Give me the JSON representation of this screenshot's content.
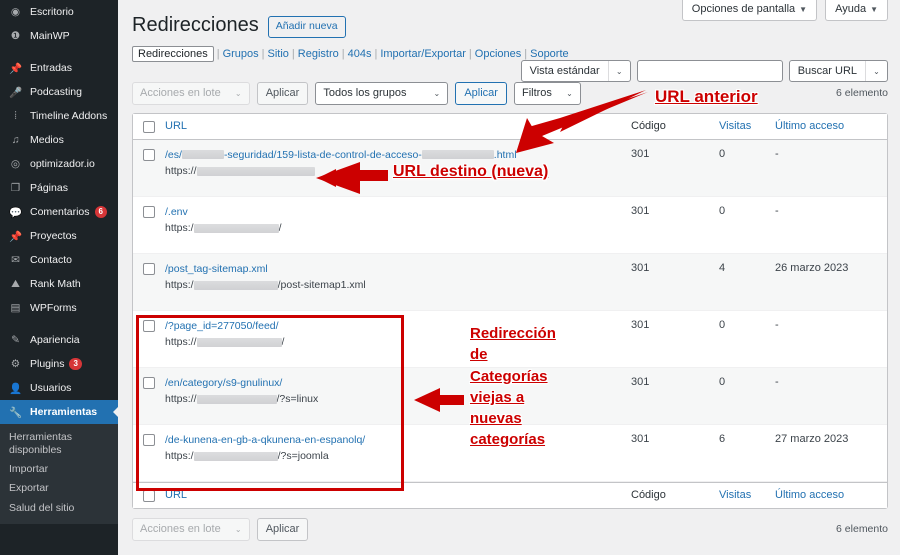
{
  "sidebar": {
    "items": [
      {
        "label": "Escritorio",
        "icon": "dashboard-icon",
        "badge": "",
        "gap": false,
        "active": false
      },
      {
        "label": "MainWP",
        "icon": "mainwp-icon",
        "badge": "",
        "gap": false,
        "active": false
      },
      {
        "label": "Entradas",
        "icon": "pin-icon",
        "badge": "",
        "gap": true,
        "active": false
      },
      {
        "label": "Podcasting",
        "icon": "microphone-icon",
        "badge": "",
        "gap": false,
        "active": false
      },
      {
        "label": "Timeline Addons",
        "icon": "timeline-icon",
        "badge": "",
        "gap": false,
        "active": false
      },
      {
        "label": "Medios",
        "icon": "media-icon",
        "badge": "",
        "gap": false,
        "active": false
      },
      {
        "label": "optimizador.io",
        "icon": "speed-icon",
        "badge": "",
        "gap": false,
        "active": false
      },
      {
        "label": "Páginas",
        "icon": "pages-icon",
        "badge": "",
        "gap": false,
        "active": false
      },
      {
        "label": "Comentarios",
        "icon": "comment-icon",
        "badge": "6",
        "gap": false,
        "active": false
      },
      {
        "label": "Proyectos",
        "icon": "pin-icon",
        "badge": "",
        "gap": false,
        "active": false
      },
      {
        "label": "Contacto",
        "icon": "envelope-icon",
        "badge": "",
        "gap": false,
        "active": false
      },
      {
        "label": "Rank Math",
        "icon": "rankmath-icon",
        "badge": "",
        "gap": false,
        "active": false
      },
      {
        "label": "WPForms",
        "icon": "form-icon",
        "badge": "",
        "gap": false,
        "active": false
      },
      {
        "label": "Apariencia",
        "icon": "brush-icon",
        "badge": "",
        "gap": true,
        "active": false
      },
      {
        "label": "Plugins",
        "icon": "plugin-icon",
        "badge": "3",
        "gap": false,
        "active": false
      },
      {
        "label": "Usuarios",
        "icon": "user-icon",
        "badge": "",
        "gap": false,
        "active": false
      },
      {
        "label": "Herramientas",
        "icon": "wrench-icon",
        "badge": "",
        "gap": false,
        "active": true
      }
    ],
    "submenu": [
      "Herramientas disponibles",
      "Importar",
      "Exportar",
      "Salud del sitio"
    ]
  },
  "header": {
    "title": "Redirecciones",
    "add_new": "Añadir nueva",
    "screen_options": "Opciones de pantalla",
    "help": "Ayuda",
    "caret": "▼"
  },
  "subnav": {
    "current": "Redirecciones",
    "items": [
      "Grupos",
      "Sitio",
      "Registro",
      "404s",
      "Importar/Exportar",
      "Opciones",
      "Soporte"
    ],
    "separator": "|"
  },
  "search": {
    "view_mode": "Vista estándar",
    "query_value": "",
    "query_placeholder": "",
    "search_target": "Buscar URL",
    "caret": "⌄"
  },
  "toolbar": {
    "bulk_actions": "Acciones en lote",
    "apply": "Aplicar",
    "group_filter": "Todos los grupos",
    "apply_group": "Aplicar",
    "filters": "Filtros",
    "item_count": "6 elemento",
    "caret": "⌄"
  },
  "table": {
    "columns": {
      "url": "URL",
      "code": "Código",
      "hits": "Visitas",
      "last_access": "Último acceso"
    },
    "rows": [
      {
        "source_pre": "/es/",
        "source_redact1": 42,
        "source_mid": "-seguridad/159-lista-de-control-de-acceso-",
        "source_redact2": 72,
        "source_post": ".html",
        "target_pre": "https://",
        "target_redact": 118,
        "target_post": "",
        "code": "301",
        "hits": "0",
        "last_access": "-"
      },
      {
        "source_pre": "/.env",
        "source_redact1": 0,
        "source_mid": "",
        "source_redact2": 0,
        "source_post": "",
        "target_pre": "https:/",
        "target_redact": 85,
        "target_post": "/",
        "code": "301",
        "hits": "0",
        "last_access": "-"
      },
      {
        "source_pre": "/post_tag-sitemap.xml",
        "source_redact1": 0,
        "source_mid": "",
        "source_redact2": 0,
        "source_post": "",
        "target_pre": "https:/",
        "target_redact": 84,
        "target_post": "/post-sitemap1.xml",
        "code": "301",
        "hits": "4",
        "last_access": "26 marzo 2023"
      },
      {
        "source_pre": "/?page_id=277050/feed/",
        "source_redact1": 0,
        "source_mid": "",
        "source_redact2": 0,
        "source_post": "",
        "target_pre": "https://",
        "target_redact": 85,
        "target_post": "/",
        "code": "301",
        "hits": "0",
        "last_access": "-"
      },
      {
        "source_pre": "/en/category/s9-gnulinux/",
        "source_redact1": 0,
        "source_mid": "",
        "source_redact2": 0,
        "source_post": "",
        "target_pre": "https://",
        "target_redact": 80,
        "target_post": "/?s=linux",
        "code": "301",
        "hits": "0",
        "last_access": "-"
      },
      {
        "source_pre": "/de-kunena-en-gb-a-qkunena-en-espanolq/",
        "source_redact1": 0,
        "source_mid": "",
        "source_redact2": 0,
        "source_post": "",
        "target_pre": "https:/",
        "target_redact": 84,
        "target_post": "/?s=joomla",
        "code": "301",
        "hits": "6",
        "last_access": "27 marzo 2023"
      }
    ]
  },
  "footer": {
    "bulk_actions": "Acciones en lote",
    "apply": "Aplicar",
    "item_count": "6 elemento"
  },
  "annotations": {
    "previous_url": "URL anterior",
    "destination_url": "URL destino (nueva)",
    "categories": "Redirección\nde\nCategorías\nviejas a\nnuevas\ncategorías",
    "color": "#cc0000"
  }
}
